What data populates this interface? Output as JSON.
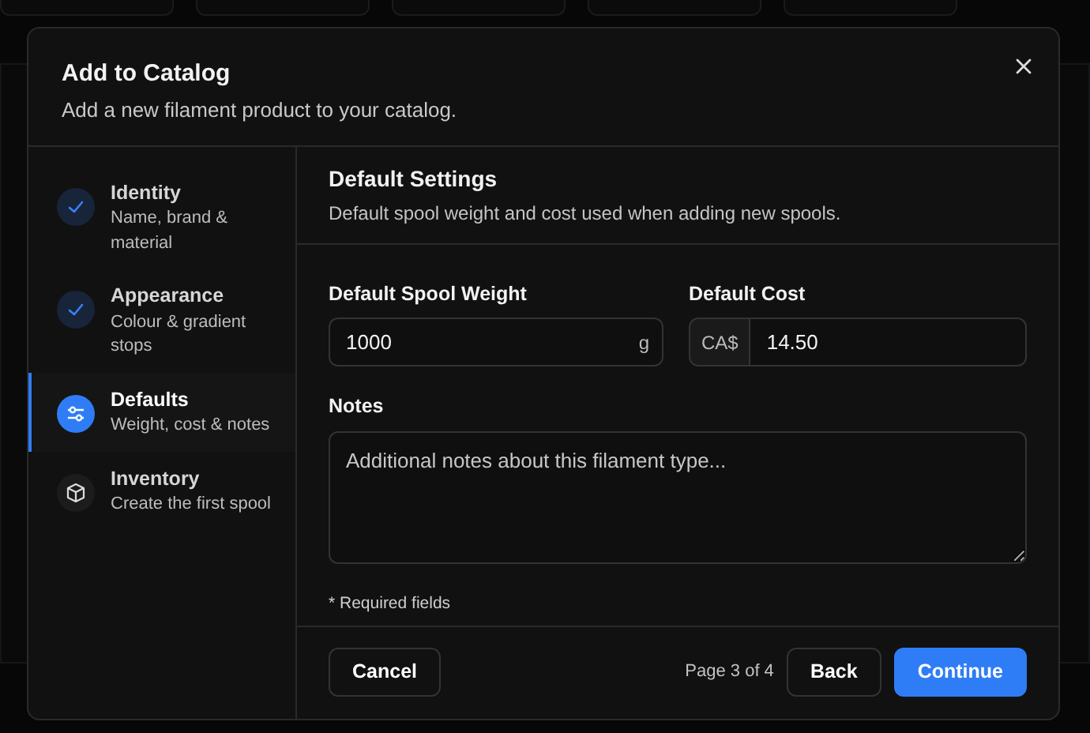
{
  "dialog": {
    "title": "Add to Catalog",
    "subtitle": "Add a new filament product to your catalog."
  },
  "steps": [
    {
      "title": "Identity",
      "subtitle": "Name, brand & material",
      "kind": "done",
      "selected": false
    },
    {
      "title": "Appearance",
      "subtitle": "Colour & gradient stops",
      "kind": "done",
      "selected": false
    },
    {
      "title": "Defaults",
      "subtitle": "Weight, cost & notes",
      "kind": "current",
      "selected": true
    },
    {
      "title": "Inventory",
      "subtitle": "Create the first spool",
      "kind": "pending",
      "selected": false
    }
  ],
  "section": {
    "title": "Default Settings",
    "subtitle": "Default spool weight and cost used when adding new spools."
  },
  "fields": {
    "weight": {
      "label": "Default Spool Weight",
      "value": "1000",
      "suffix": "g"
    },
    "cost": {
      "label": "Default Cost",
      "prefix": "CA$",
      "value": "14.50"
    },
    "notes": {
      "label": "Notes",
      "placeholder": "Additional notes about this filament type..."
    }
  },
  "required_note": "* Required fields",
  "footer": {
    "cancel": "Cancel",
    "page": "Page 3 of 4",
    "back": "Back",
    "continue": "Continue"
  }
}
